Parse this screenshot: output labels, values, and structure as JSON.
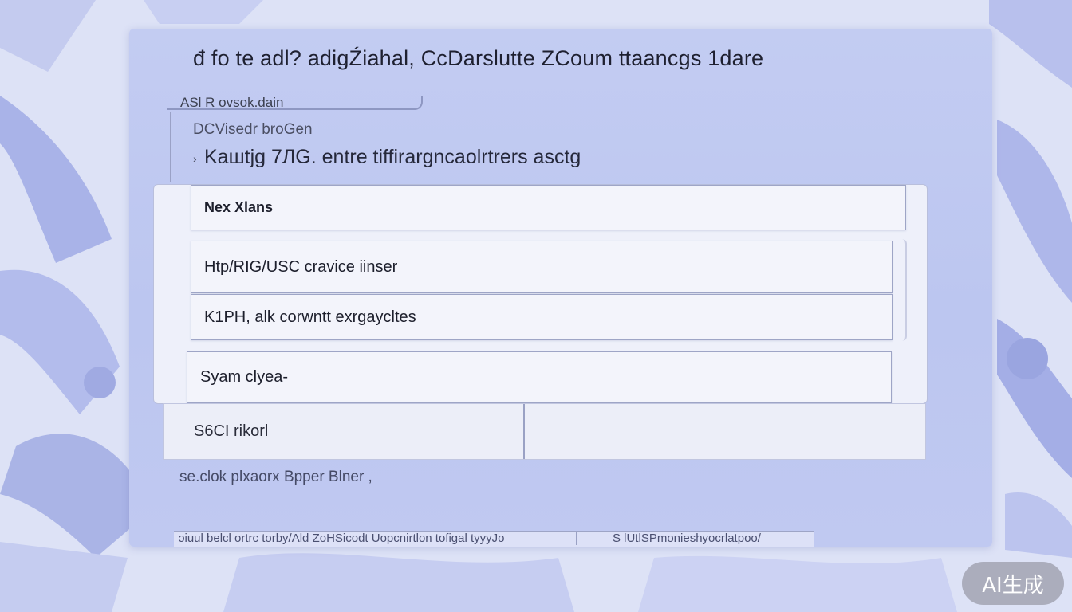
{
  "window": {
    "title": "đ fo  te adl? adigŹiahal, CcDarslutte ZCoum  ttaancgs 1dare"
  },
  "tab": {
    "label": "ASl R ovsok.dain"
  },
  "section": {
    "sub_label": "DCVisedr broGen",
    "arrow": "›",
    "description": "Kaшtjg 7ЛG.  entre  tiffirargncaolrtrers asctg"
  },
  "list": {
    "items": [
      {
        "label": "Nex Xlans"
      },
      {
        "label": "Htp/RIG/USC cravice iinser"
      },
      {
        "label": "K1PH, alk corwntt exrgaycltes"
      },
      {
        "label": "Syam clyea-"
      },
      {
        "label": "S6CI rikorl"
      }
    ]
  },
  "footer": {
    "hint": "se.clok plxaorx Bpper Blner ,"
  },
  "status_bar": {
    "left": "ɔiuul belcl ortrc torby/Ald ZoHSicodt Uopcnirtlon tofigal tyyyJo",
    "right": "S lUtlSPmonieshyocrlatpoo/",
    "separator": "|"
  },
  "badge": {
    "label": "AI生成"
  },
  "colors": {
    "panel": "#c3ccf2",
    "background": "#dfe3f7",
    "row": "#f3f4fb",
    "text": "#1d1f2c",
    "badge": "#8a8a94"
  }
}
